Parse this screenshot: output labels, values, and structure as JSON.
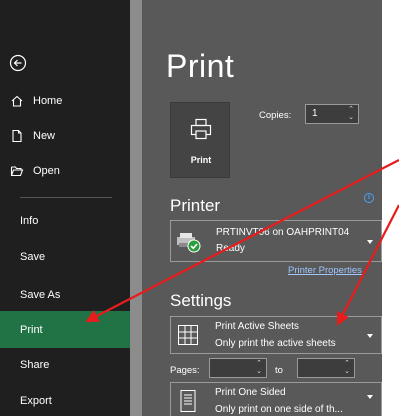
{
  "sidebar": {
    "back_icon": "back-arrow-icon",
    "items": [
      {
        "label": "Home",
        "icon": "home-icon"
      },
      {
        "label": "New",
        "icon": "new-document-icon"
      },
      {
        "label": "Open",
        "icon": "open-folder-icon"
      },
      {
        "label": "Info"
      },
      {
        "label": "Save"
      },
      {
        "label": "Save As"
      },
      {
        "label": "Print",
        "active": true
      },
      {
        "label": "Share"
      },
      {
        "label": "Export"
      }
    ],
    "active_color": "#217346"
  },
  "main": {
    "title": "Print",
    "print_button_label": "Print",
    "copies_label": "Copies:",
    "copies_value": "1",
    "printer_heading": "Printer",
    "printer_name": "PRTINVT06 on OAHPRINT04",
    "printer_status": "Ready",
    "printer_properties_link": "Printer Properties",
    "settings_heading": "Settings",
    "scope_title": "Print Active Sheets",
    "scope_desc": "Only print the active sheets",
    "pages_label": "Pages:",
    "pages_to_label": "to",
    "sides_title": "Print One Sided",
    "sides_desc": "Only print on one side of th..."
  },
  "annotation_color": "#e81c1c"
}
